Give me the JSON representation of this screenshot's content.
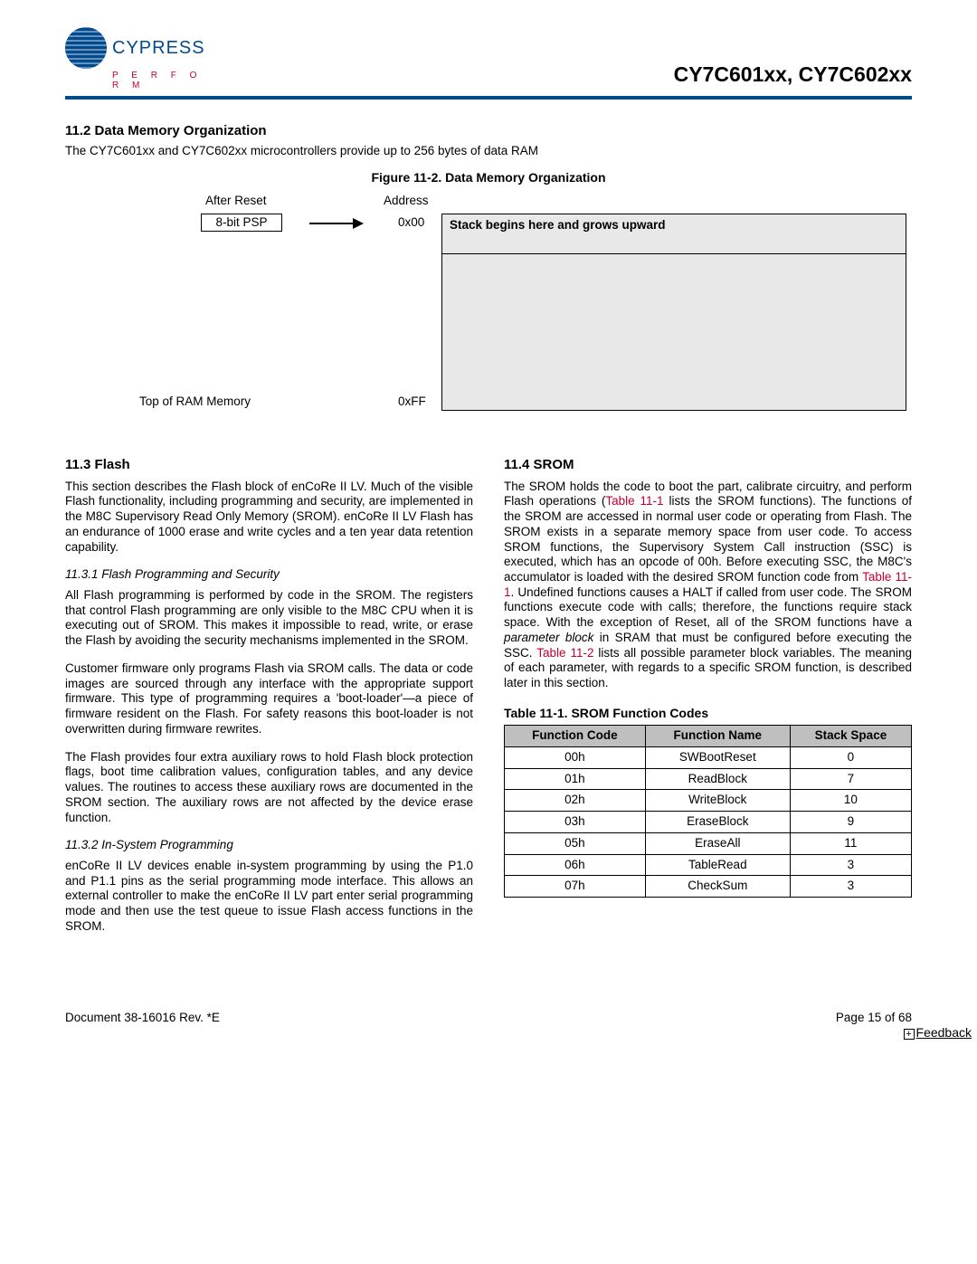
{
  "header": {
    "logo_text": "CYPRESS",
    "logo_sub": "P E R F O R M",
    "title": "CY7C601xx, CY7C602xx"
  },
  "s112": {
    "heading": "11.2  Data Memory Organization",
    "text": "The CY7C601xx and CY7C602xx microcontrollers provide up to 256 bytes of data RAM",
    "fig_caption": "Figure 11-2.  Data Memory Organization",
    "after_reset": "After Reset",
    "psp": "8-bit PSP",
    "address": "Address",
    "addr_00": "0x00",
    "stack_note": "Stack begins here and grows upward",
    "top_of_ram": "Top of RAM Memory",
    "addr_ff": "0xFF"
  },
  "s113": {
    "heading": "11.3  Flash",
    "p1": "This section describes the Flash block of enCoRe II LV. Much of the visible Flash functionality, including programming and security, are implemented in the M8C Supervisory Read Only Memory (SROM). enCoRe II LV Flash has an endurance of 1000 erase and write cycles and a ten year data retention capability.",
    "sub1": "11.3.1  Flash Programming and Security",
    "p2": "All Flash programming is performed by code in the SROM. The registers that control Flash programming are only visible to the M8C CPU when it is executing out of SROM. This makes it impossible to read, write, or erase the Flash by avoiding the security mechanisms implemented in the SROM.",
    "p3": "Customer firmware only programs Flash via SROM calls. The data or code images are sourced through any interface with the appropriate support firmware. This type of programming requires a 'boot-loader'—a piece of firmware resident on the Flash. For safety reasons this boot-loader is not overwritten during firmware rewrites.",
    "p4": "The Flash provides four extra auxiliary rows to hold Flash block protection flags, boot time calibration values, configuration tables, and any device values. The routines to access these auxiliary rows are documented in the SROM section. The auxiliary rows are not affected by the device erase function.",
    "sub2": "11.3.2  In-System Programming",
    "p5": "enCoRe II LV devices enable in-system programming by using the P1.0 and P1.1 pins as the serial programming mode interface. This allows an external controller to make the enCoRe II LV part enter serial programming mode and then use the test queue to issue Flash access functions in the SROM."
  },
  "s114": {
    "heading": "11.4  SROM",
    "p1a": "The SROM holds the code to boot the part, calibrate circuitry, and perform Flash operations (",
    "p1link1": "Table 11-1",
    "p1b": " lists the SROM functions). The functions of the SROM are accessed in normal user code or operating from Flash. The SROM exists in a separate memory space from user code. To access SROM functions, the Supervisory System Call instruction (SSC) is executed, which has an opcode of 00h. Before executing SSC, the M8C's accumulator is loaded with the desired SROM function code from ",
    "p1link2": "Table 11-1",
    "p1c": ". Undefined functions causes a HALT if called from user code. The SROM functions execute code with calls; therefore, the functions require stack space. With the exception of Reset, all of the SROM functions have a ",
    "p1i": "parameter block",
    "p1d": " in SRAM that must be configured before executing the SSC. ",
    "p1link3": "Table 11-2",
    "p1e": " lists all possible parameter block variables. The meaning of each parameter, with regards to a specific SROM function, is described later in this section.",
    "table_caption": "Table 11-1.  SROM Function Codes",
    "th1": "Function Code",
    "th2": "Function Name",
    "th3": "Stack Space"
  },
  "chart_data": {
    "type": "table",
    "title": "Table 11-1. SROM Function Codes",
    "columns": [
      "Function Code",
      "Function Name",
      "Stack Space"
    ],
    "rows": [
      {
        "code": "00h",
        "name": "SWBootReset",
        "stack": "0"
      },
      {
        "code": "01h",
        "name": "ReadBlock",
        "stack": "7"
      },
      {
        "code": "02h",
        "name": "WriteBlock",
        "stack": "10"
      },
      {
        "code": "03h",
        "name": "EraseBlock",
        "stack": "9"
      },
      {
        "code": "05h",
        "name": "EraseAll",
        "stack": "11"
      },
      {
        "code": "06h",
        "name": "TableRead",
        "stack": "3"
      },
      {
        "code": "07h",
        "name": "CheckSum",
        "stack": "3"
      }
    ]
  },
  "footer": {
    "doc": "Document 38-16016 Rev. *E",
    "page": "Page 15 of 68",
    "feedback": "Feedback"
  }
}
